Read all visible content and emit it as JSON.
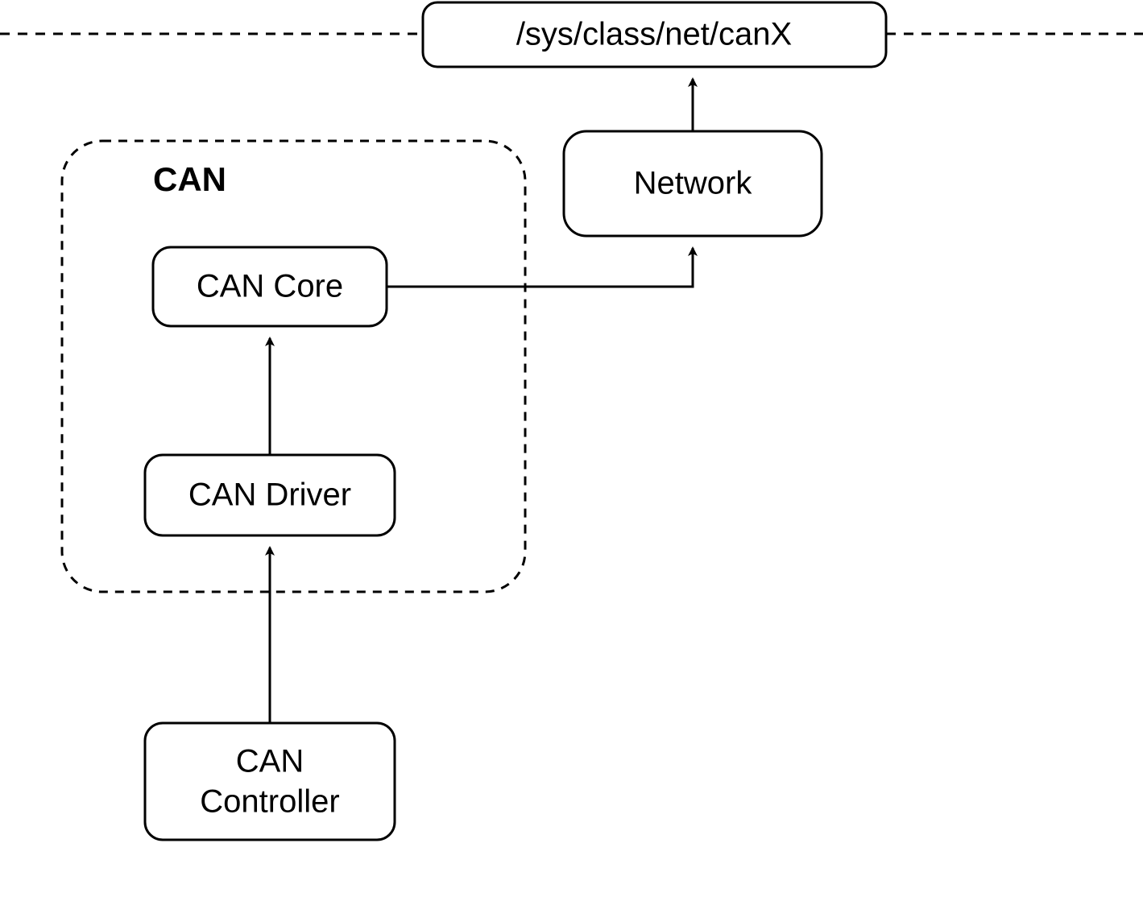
{
  "diagram": {
    "group_label": "CAN",
    "boxes": {
      "sysfs": "/sys/class/net/canX",
      "network": "Network",
      "can_core": "CAN Core",
      "can_driver": "CAN Driver",
      "can_controller_line1": "CAN",
      "can_controller_line2": "Controller"
    }
  }
}
